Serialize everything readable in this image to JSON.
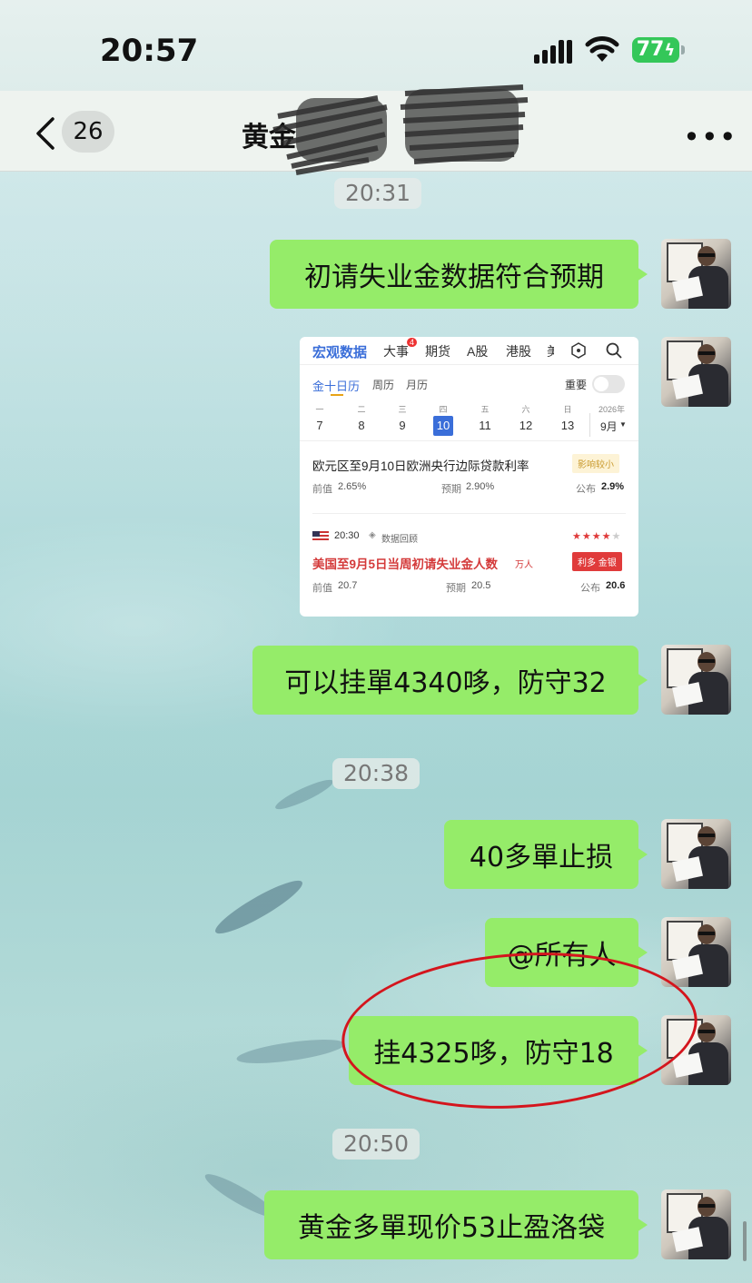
{
  "status_bar": {
    "time": "20:57",
    "battery": "77"
  },
  "header": {
    "unread_count": "26",
    "chat_title": "黄金"
  },
  "timestamps": {
    "t1": "20:31",
    "t2": "20:38",
    "t3": "20:50"
  },
  "messages": {
    "m1": "初请失业金数据符合预期",
    "m2": "可以挂單4340哆，防守32",
    "m3": "40多單止损",
    "m4": "@所有人",
    "m5": "挂4325哆，防守18",
    "m6": "黄金多單现价53止盈洛袋"
  },
  "shared_card": {
    "tabs": [
      "宏观数据",
      "大事",
      "期货",
      "A股",
      "港股",
      "美"
    ],
    "tab_badge": "4",
    "subtabs": [
      "金十日历",
      "周历",
      "月历"
    ],
    "important_label": "重要",
    "weekdays": [
      "一",
      "二",
      "三",
      "四",
      "五",
      "六",
      "日"
    ],
    "dates": [
      "7",
      "8",
      "9",
      "10",
      "11",
      "12",
      "13"
    ],
    "year": "2026年",
    "month": "9月",
    "event1": {
      "title": "欧元区至9月10日欧洲央行边际贷款利率",
      "impact": "影响较小",
      "prev_label": "前值",
      "prev": "2.65%",
      "fore_label": "预期",
      "fore": "2.90%",
      "pub_label": "公布",
      "pub": "2.9%"
    },
    "event2": {
      "time": "20:30",
      "review": "数据回顾",
      "title": "美国至9月5日当周初请失业金人数",
      "unit": "万人",
      "impact": "利多 金银",
      "prev_label": "前值",
      "prev": "20.7",
      "fore_label": "预期",
      "fore": "20.5",
      "pub_label": "公布",
      "pub": "20.6"
    }
  },
  "colors": {
    "bubble": "#95ec69",
    "accent_blue": "#3a6ed9",
    "alert_red": "#d4151d"
  }
}
